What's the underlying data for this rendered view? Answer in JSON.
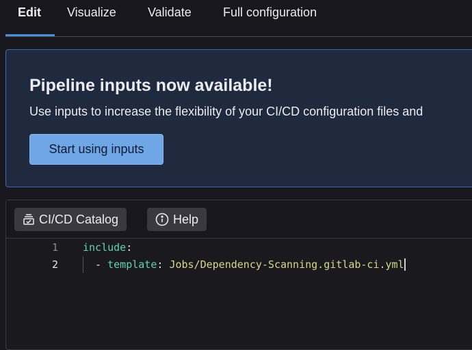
{
  "tabs": [
    {
      "label": "Edit",
      "active": true
    },
    {
      "label": "Visualize"
    },
    {
      "label": "Validate"
    },
    {
      "label": "Full configuration"
    }
  ],
  "banner": {
    "title": "Pipeline inputs now available!",
    "description": "Use inputs to increase the flexibility of your CI/CD configuration files and",
    "button": "Start using inputs"
  },
  "toolbar": {
    "catalog": "CI/CD Catalog",
    "help": "Help"
  },
  "code": {
    "lines": [
      {
        "num": "1",
        "key": "include",
        "colon": ":"
      },
      {
        "num": "2",
        "dash": "  - ",
        "key": "template",
        "colon": ": ",
        "value": "Jobs/Dependency-Scanning.gitlab-ci.yml"
      }
    ]
  }
}
